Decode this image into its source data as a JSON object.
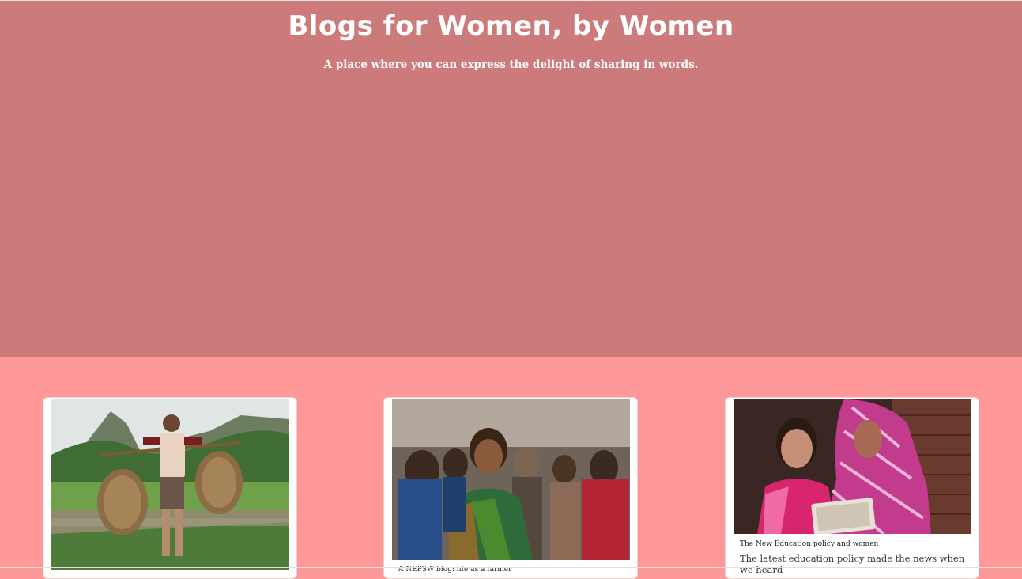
{
  "hero": {
    "title": "Blogs for Women, by Women",
    "subtitle": "A place where you can express the delight of sharing in words."
  },
  "colors": {
    "hero_bg": "#cd7a7b",
    "page_bg": "#ff9999",
    "card_bg": "#ffffff"
  },
  "cards": [
    {
      "image": "woman-carrying-rice-seedlings-photo",
      "title": "",
      "text": ""
    },
    {
      "image": "group-of-women-smiling-photo",
      "title": "A NEPSW blog: life as a farmer",
      "text": ""
    },
    {
      "image": "women-reading-tablet-photo",
      "title": "The New Education policy and women",
      "text": "The latest education policy made the news when we heard"
    }
  ]
}
